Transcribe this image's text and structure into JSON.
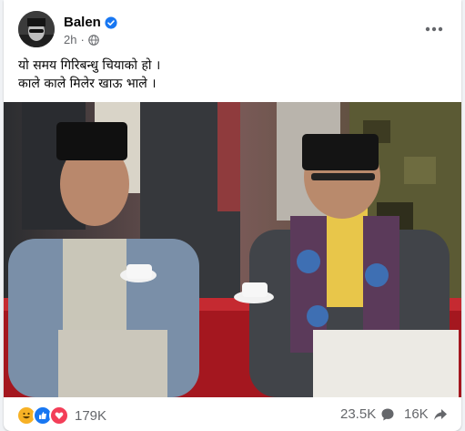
{
  "post": {
    "author": "Balen",
    "time": "2h",
    "caption_line1": "यो समय गिरिबन्धु चियाको हो ।",
    "caption_line2": "काले काले मिलेर खाऊ भाले ।",
    "reactions_count": "179K",
    "comments_count": "23.5K",
    "shares_count": "16K"
  },
  "icons": {
    "verified": "verified-badge-icon",
    "privacy": "globe-icon",
    "more": "more-horizontal-icon",
    "reactions": [
      "haha-reaction-icon",
      "like-reaction-icon",
      "love-reaction-icon"
    ],
    "comments": "comment-icon",
    "share": "share-icon"
  },
  "colors": {
    "like": "#1877f2",
    "love": "#f33e58",
    "haha": "#f7b125",
    "secondary_text": "#65676b"
  }
}
